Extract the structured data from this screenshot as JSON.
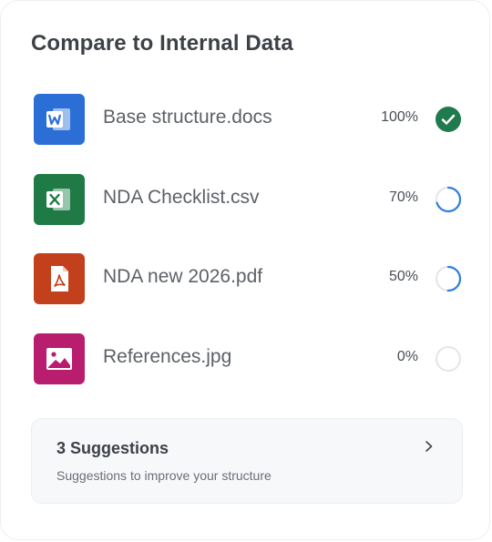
{
  "card": {
    "title": "Compare to Internal Data"
  },
  "files": [
    {
      "name": "Base structure.docs",
      "percent_label": "100%",
      "progress": 1.0,
      "status": "complete",
      "icon": "word-icon",
      "icon_color": "#2b6fd6"
    },
    {
      "name": "NDA Checklist.csv",
      "percent_label": "70%",
      "progress": 0.7,
      "status": "in-progress",
      "icon": "excel-icon",
      "icon_color": "#1f7a45"
    },
    {
      "name": "NDA new 2026.pdf",
      "percent_label": "50%",
      "progress": 0.5,
      "status": "in-progress",
      "icon": "pdf-icon",
      "icon_color": "#c2401b"
    },
    {
      "name": "References.jpg",
      "percent_label": "0%",
      "progress": 0.0,
      "status": "not-started",
      "icon": "image-icon",
      "icon_color": "#b81e6d"
    }
  ],
  "suggestions": {
    "title": "3 Suggestions",
    "subtitle": "Suggestions to improve your structure",
    "icon": "chevron-right-icon"
  },
  "colors": {
    "complete": "#1f7a4d",
    "progress": "#2f7fe0",
    "track": "#e3e5e8"
  }
}
